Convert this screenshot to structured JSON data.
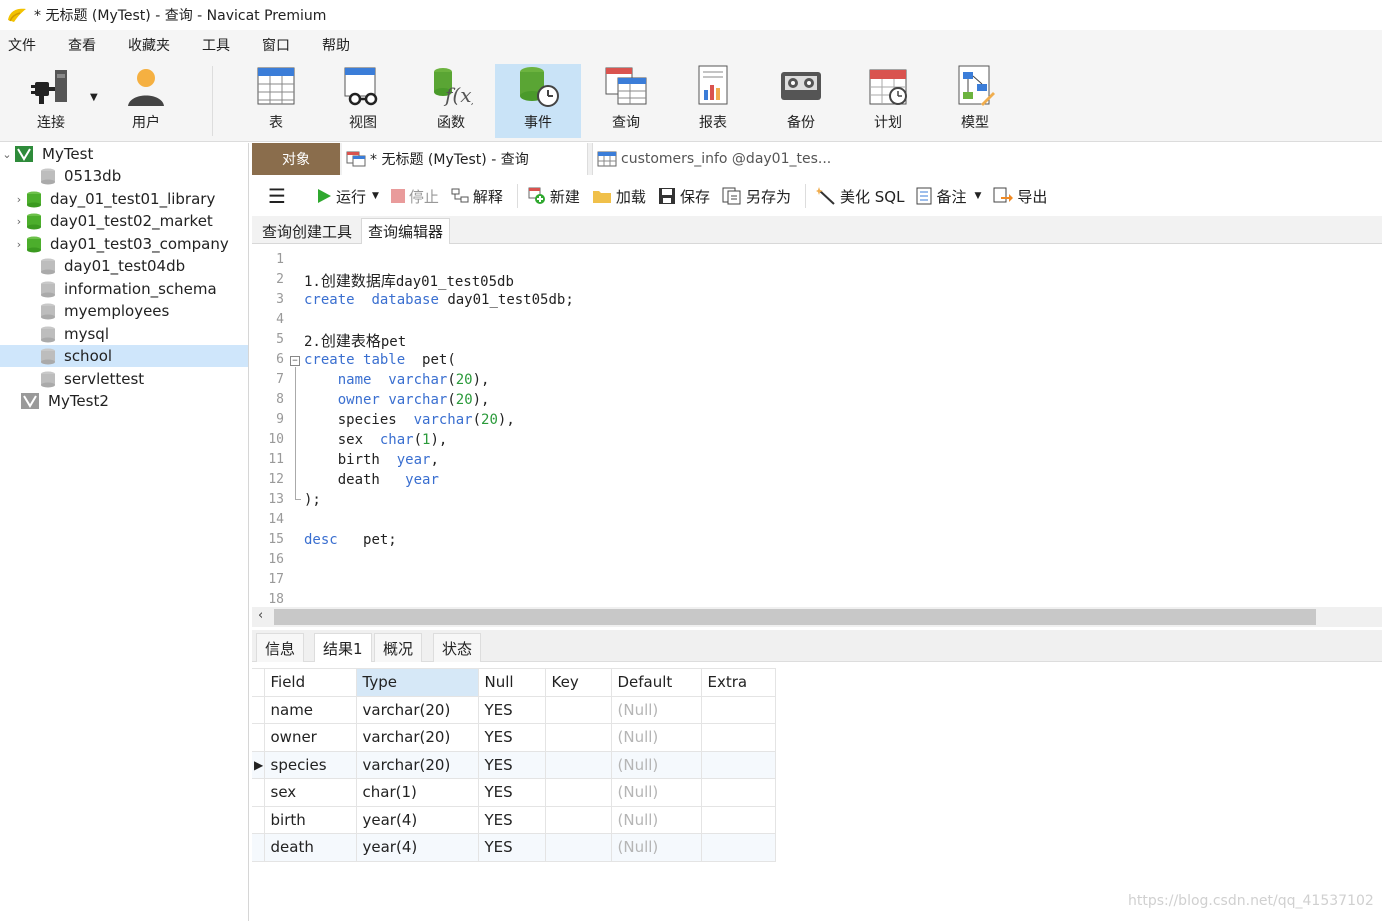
{
  "window": {
    "title": "* 无标题 (MyTest) - 查询 - Navicat Premium"
  },
  "menu": [
    "文件",
    "查看",
    "收藏夹",
    "工具",
    "窗口",
    "帮助"
  ],
  "toolbar": {
    "connect": "连接",
    "user": "用户",
    "table": "表",
    "view": "视图",
    "function": "函数",
    "event": "事件",
    "query": "查询",
    "report": "报表",
    "backup": "备份",
    "schedule": "计划",
    "model": "模型"
  },
  "sidebar": {
    "conn1": "MyTest",
    "dbs": [
      "0513db",
      "day_01_test01_library",
      "day01_test02_market",
      "day01_test03_company",
      "day01_test04db",
      "information_schema",
      "myemployees",
      "mysql",
      "school",
      "servlettest"
    ],
    "conn2": "MyTest2"
  },
  "tabs": {
    "objects": "对象",
    "query_tab": "* 无标题 (MyTest) - 查询",
    "customers_tab": "customers_info @day01_tes..."
  },
  "query_toolbar": {
    "run": "运行",
    "stop": "停止",
    "explain": "解释",
    "new": "新建",
    "load": "加载",
    "save": "保存",
    "save_as": "另存为",
    "beautify": "美化 SQL",
    "comment": "备注",
    "export": "导出"
  },
  "subtabs": {
    "builder": "查询创建工具",
    "editor": "查询编辑器"
  },
  "editor": {
    "line_numbers": [
      "1",
      "2",
      "3",
      "4",
      "5",
      "6",
      "7",
      "8",
      "9",
      "10",
      "11",
      "12",
      "13",
      "14",
      "15",
      "16",
      "17",
      "18"
    ],
    "l2_num": "1.",
    "l2_cn": "创建数据库",
    "l2_rest": "day01_test05db",
    "l3_create": "create",
    "l3_database": "database",
    "l3_rest": "day01_test05db;",
    "l5_num": "2.",
    "l5_cn": "创建表格",
    "l5_rest": "pet",
    "l6_create": "create",
    "l6_table": "table",
    "l6_rest": "pet(",
    "l7_name": "name",
    "l7_type": "varchar",
    "l7_open": "(",
    "l7_n": "20",
    "l7_close": "),",
    "l8_name": "owner",
    "l8_type": "varchar",
    "l8_open": "(",
    "l8_n": "20",
    "l8_close": "),",
    "l9_name": "species",
    "l9_type": "varchar",
    "l9_open": "(",
    "l9_n": "20",
    "l9_close": "),",
    "l10_name": "sex",
    "l10_type": "char",
    "l10_open": "(",
    "l10_n": "1",
    "l10_close": "),",
    "l11_name": "birth",
    "l11_type": "year",
    "l11_close": ",",
    "l12_name": "death",
    "l12_type": "year",
    "l13": ");",
    "l15_desc": "desc",
    "l15_rest": "pet;"
  },
  "result_tabs": [
    "信息",
    "结果1",
    "概况",
    "状态"
  ],
  "result": {
    "headers": [
      "Field",
      "Type",
      "Null",
      "Key",
      "Default",
      "Extra"
    ],
    "rows": [
      [
        "name",
        "varchar(20)",
        "YES",
        "",
        "(Null)",
        ""
      ],
      [
        "owner",
        "varchar(20)",
        "YES",
        "",
        "(Null)",
        ""
      ],
      [
        "species",
        "varchar(20)",
        "YES",
        "",
        "(Null)",
        ""
      ],
      [
        "sex",
        "char(1)",
        "YES",
        "",
        "(Null)",
        ""
      ],
      [
        "birth",
        "year(4)",
        "YES",
        "",
        "(Null)",
        ""
      ],
      [
        "death",
        "year(4)",
        "YES",
        "",
        "(Null)",
        ""
      ]
    ]
  },
  "watermark": "https://blog.csdn.net/qq_41537102"
}
